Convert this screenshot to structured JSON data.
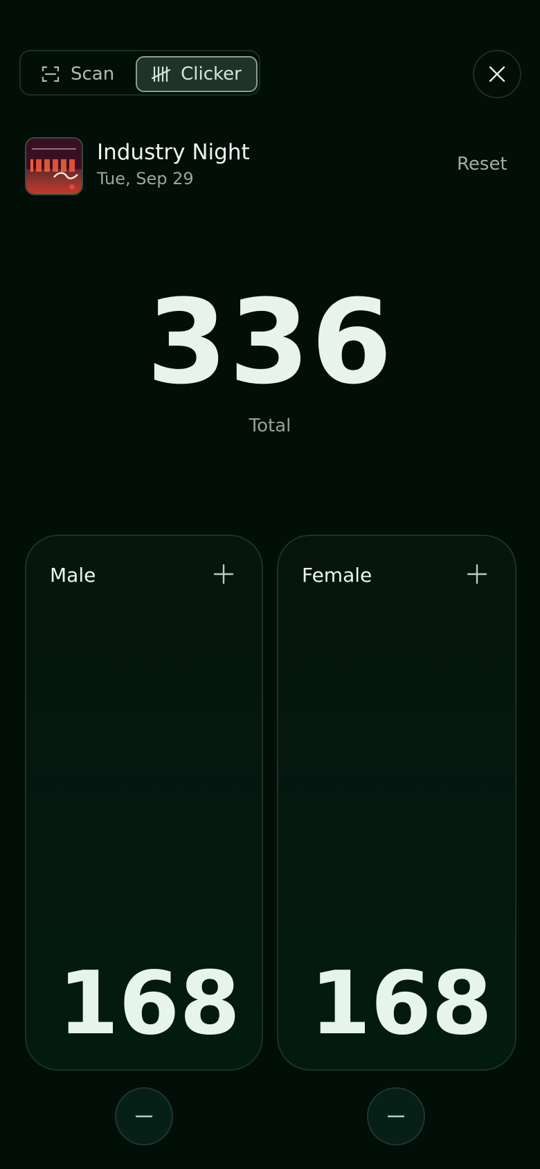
{
  "mode_switch": {
    "scan_label": "Scan",
    "clicker_label": "Clicker",
    "active": "Clicker",
    "scan_icon": "scan-frame-icon",
    "clicker_icon": "tally-marks-icon"
  },
  "close_icon": "close-icon",
  "event": {
    "title": "Industry Night",
    "date": "Tue, Sep 29"
  },
  "reset_label": "Reset",
  "total": {
    "value": "336",
    "label": "Total"
  },
  "counters": [
    {
      "label": "Male",
      "value": "168",
      "plus_icon": "plus-icon",
      "minus_icon": "minus-icon"
    },
    {
      "label": "Female",
      "value": "168",
      "plus_icon": "plus-icon",
      "minus_icon": "minus-icon"
    }
  ],
  "colors": {
    "background": "#020e08",
    "card_border": "#1f3127",
    "active_segment": "#203328",
    "text_primary": "#e6f4ec",
    "text_muted": "#93a399"
  }
}
